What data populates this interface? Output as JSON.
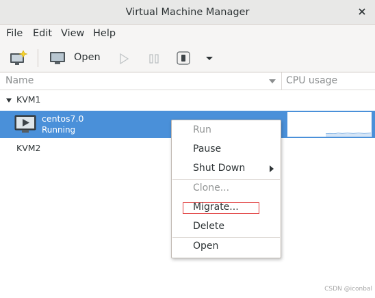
{
  "window": {
    "title": "Virtual Machine Manager",
    "close_icon": "close-icon"
  },
  "menubar": {
    "items": [
      "File",
      "Edit",
      "View",
      "Help"
    ]
  },
  "toolbar": {
    "open_label": "Open"
  },
  "columns": {
    "name": "Name",
    "cpu": "CPU usage"
  },
  "connections": [
    {
      "name": "KVM1",
      "expanded": true,
      "vms": [
        {
          "name": "centos7.0",
          "status": "Running",
          "selected": true
        }
      ]
    },
    {
      "name": "KVM2",
      "expanded": false,
      "vms": []
    }
  ],
  "context_menu": {
    "items": [
      {
        "label": "Run",
        "enabled": false
      },
      {
        "label": "Pause",
        "enabled": true
      },
      {
        "label": "Shut Down",
        "enabled": true,
        "submenu": true
      },
      {
        "label": "Clone...",
        "enabled": false
      },
      {
        "label": "Migrate...",
        "enabled": true,
        "highlighted": true
      },
      {
        "label": "Delete",
        "enabled": true
      },
      {
        "label": "Open",
        "enabled": true
      }
    ]
  },
  "colors": {
    "selection": "#4a90d9",
    "highlight_box": "#e03a3a",
    "titlebar": "#e8e8e7"
  },
  "watermark": "CSDN @iconbal"
}
